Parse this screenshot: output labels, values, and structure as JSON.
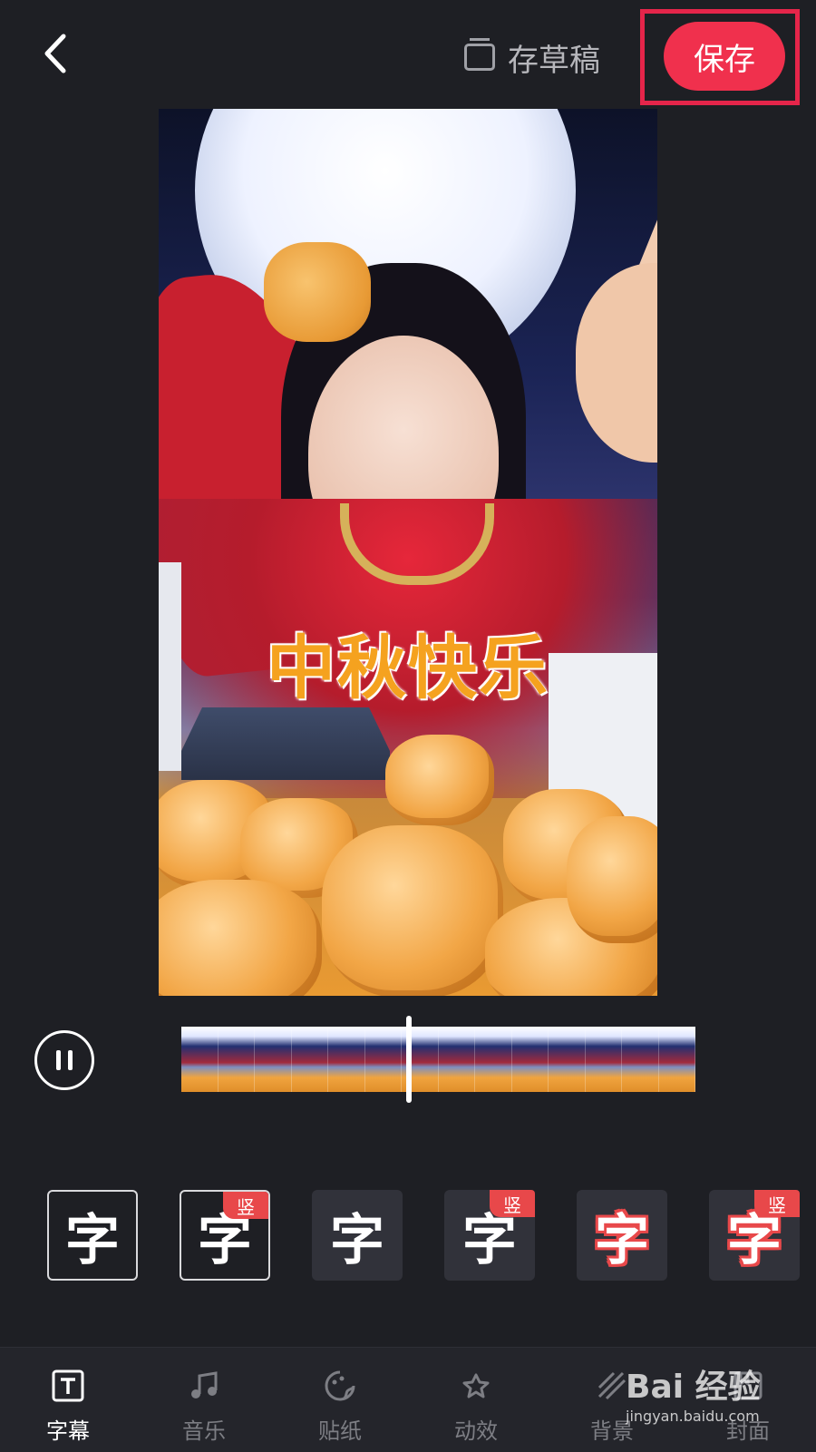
{
  "header": {
    "draft_label": "存草稿",
    "save_label": "保存"
  },
  "preview": {
    "overlay_text": "中秋快乐"
  },
  "style_options": [
    {
      "char": "字",
      "badge": ""
    },
    {
      "char": "字",
      "badge": "竖"
    },
    {
      "char": "字",
      "badge": ""
    },
    {
      "char": "字",
      "badge": "竖"
    },
    {
      "char": "字",
      "badge": ""
    },
    {
      "char": "字",
      "badge": "竖"
    }
  ],
  "bottom_nav": [
    {
      "label": "字幕",
      "icon": "text-icon",
      "active": true
    },
    {
      "label": "音乐",
      "icon": "music-icon",
      "active": false
    },
    {
      "label": "贴纸",
      "icon": "sticker-icon",
      "active": false
    },
    {
      "label": "动效",
      "icon": "effect-icon",
      "active": false
    },
    {
      "label": "背景",
      "icon": "background-icon",
      "active": false
    },
    {
      "label": "封面",
      "icon": "cover-icon",
      "active": false
    }
  ],
  "watermark": {
    "brand": "Bai 经验",
    "url": "jingyan.baidu.com"
  },
  "colors": {
    "accent": "#f0304d",
    "background": "#1e1f24"
  }
}
